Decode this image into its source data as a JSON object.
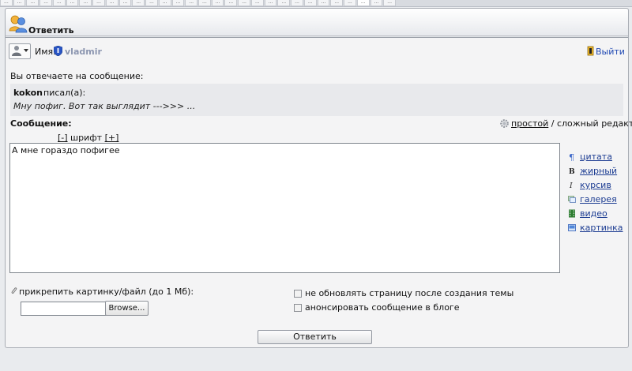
{
  "browser_tabs": [
    "...",
    "...",
    "...",
    "...",
    "...",
    "...",
    "...",
    "...",
    "...",
    "...",
    "...",
    "...",
    "...",
    "...",
    "...",
    "...",
    "...",
    "...",
    "...",
    "...",
    "...",
    "...",
    "...",
    "...",
    "...",
    "...",
    "...",
    "...",
    "...",
    "..."
  ],
  "header": {
    "title": "Ответить",
    "icon": "users-icon"
  },
  "user": {
    "avatar_icon": "person-icon",
    "name_label": "Имя:",
    "badge_icon": "shield-icon",
    "username": "vladmir",
    "logout_label": "Выйти",
    "logout_icon": "door-exit-icon"
  },
  "reply": {
    "label": "Вы отвечаете на сообщение:",
    "quote_author": "kokon",
    "quote_wrote": "писал(а):",
    "quote_text": "Мну пофиг. Вот так выглядит --->>> ..."
  },
  "message": {
    "label": "Сообщение:",
    "editor_simple": "простой",
    "editor_separator": " / ",
    "editor_complex": "сложный редактор",
    "font_decrease": "[-]",
    "font_label": " шрифт ",
    "font_increase": "[+]",
    "text": "А мне гораздо пофигее"
  },
  "format_toolbar": [
    {
      "label": "цитата",
      "icon": "quote-icon"
    },
    {
      "label": "жирный",
      "icon": "bold-icon"
    },
    {
      "label": "курсив",
      "icon": "italic-icon"
    },
    {
      "label": "галерея",
      "icon": "gallery-icon"
    },
    {
      "label": "видео",
      "icon": "video-icon"
    },
    {
      "label": "картинка",
      "icon": "image-icon"
    }
  ],
  "attach": {
    "label": "прикрепить картинку/файл (до 1 Мб):",
    "browse_label": "Browse..."
  },
  "options": [
    {
      "label": "не обновлять страницу после создания темы",
      "checked": false
    },
    {
      "label": "анонсировать сообщение в блоге",
      "checked": false
    }
  ],
  "submit_label": "Ответить",
  "colors": {
    "link": "#2049b3",
    "username": "#8c96b0",
    "panel_bg": "#f4f4f5",
    "quote_bg": "#e8e9ec"
  }
}
